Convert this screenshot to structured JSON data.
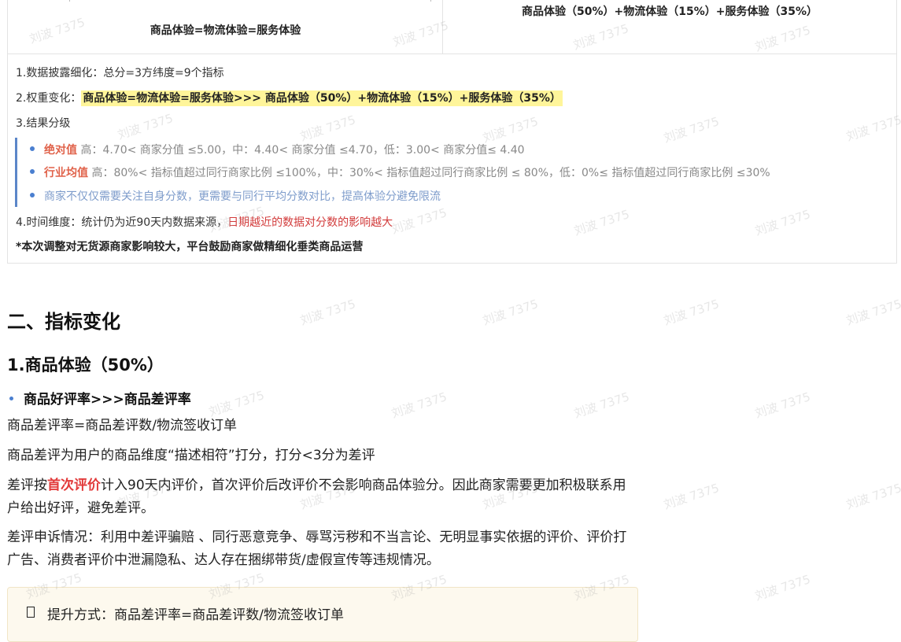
{
  "comparison": {
    "old_formula": "商品体验=物流体验=服务体验",
    "new_formula": "商品体验（50%）+物流体验（15%）+服务体验（35%）"
  },
  "summary": {
    "item1": "1.数据披露细化：总分=3方纬度=9个指标",
    "item2_prefix": "2.权重变化：",
    "item2_highlight": "商品体验=物流体验=服务体验>>> 商品体验（50%）+物流体验（15%）+服务体验（35%）",
    "item3": "3.结果分级",
    "grades": [
      {
        "key": "绝对值",
        "text": " 高：4.70< 商家分值 ≤5.00，中：4.40< 商家分值 ≤4.70，低：3.00< 商家分值≤ 4.40"
      },
      {
        "key": "行业均值",
        "text": " 高：80%< 指标值超过同行商家比例 ≤100%，中：30%< 指标值超过同行商家比例 ≤ 80%，低：0%≤ 指标值超过同行商家比例 ≤30%"
      }
    ],
    "note": "商家不仅仅需要关注自身分数，更需要与同行平均分数对比，提高体验分避免限流",
    "item4_prefix": "4.时间维度：统计仍为近90天内数据来源，",
    "item4_red": "日期越近的数据对分数的影响越大",
    "footnote": "*本次调整对无货源商家影响较大，平台鼓励商家做精细化垂类商品运营"
  },
  "section": {
    "h2": "二、指标变化",
    "h3": "1.商品体验（50%）",
    "bullet": "商品好评率>>>商品差评率",
    "p1": "商品差评率=商品差评数/物流签收订单",
    "p2": "商品差评为用户的商品维度“描述相符”打分，打分<3分为差评",
    "p3_pre": "差评按",
    "p3_red": "首次评价",
    "p3_post": "计入90天内评价，首次评价后改评价不会影响商品体验分。因此商家需要更加积极联系用户给出好评，避免差评。",
    "p4": "差评申诉情况：利用中差评骗赔 、同行恶意竞争、辱骂污秽和不当言论、无明显事实依据的评价、评价打广告、消费者评价中泄漏隐私、达人存在捆绑带货/虚假宣传等违规情况。",
    "tip": "提升方式：商品差评率=商品差评数/物流签收订单"
  },
  "watermark": "刘波 7375",
  "colors": {
    "highlight": "#fff59a",
    "accent_red": "#e23a3a",
    "grade_key": "#e0624a",
    "quote_border": "#5b86c9",
    "bullet_blue": "#4a7fd0"
  }
}
